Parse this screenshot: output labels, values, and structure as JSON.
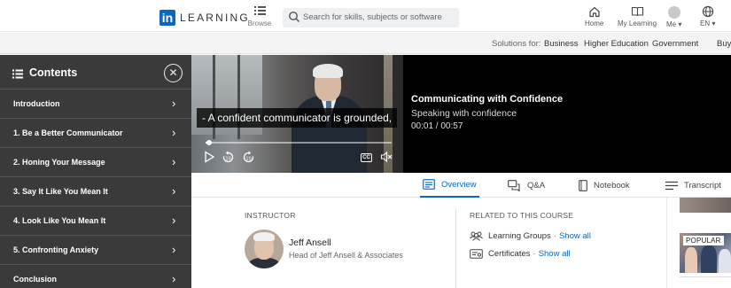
{
  "topnav": {
    "logo_mark": "in",
    "logo_text": "LEARNING",
    "browse_label": "Browse",
    "search_placeholder": "Search for skills, subjects or software",
    "home_label": "Home",
    "my_learning_label": "My Learning",
    "me_label": "Me",
    "language_label": "EN"
  },
  "subnav": {
    "solutions_label": "Solutions for:",
    "items": [
      "Business",
      "Higher Education",
      "Government",
      "Buy"
    ]
  },
  "sidebar": {
    "title": "Contents",
    "close_glyph": "✕",
    "items": [
      {
        "label": "Introduction"
      },
      {
        "label": "1. Be a Better Communicator"
      },
      {
        "label": "2. Honing Your Message"
      },
      {
        "label": "3. Say It Like You Mean It"
      },
      {
        "label": "4. Look Like You Mean It"
      },
      {
        "label": "5. Confronting Anxiety"
      },
      {
        "label": "Conclusion"
      }
    ]
  },
  "video": {
    "caption": "- A confident communicator is grounded,",
    "progress_fraction": 0.02,
    "cc_label": "CC"
  },
  "video_info": {
    "course_title": "Communicating with Confidence",
    "video_title": "Speaking with confidence",
    "time": "00:01 / 00:57"
  },
  "tabs": [
    {
      "label": "Overview",
      "icon": "overview-icon",
      "active": true
    },
    {
      "label": "Q&A",
      "icon": "qa-icon",
      "active": false
    },
    {
      "label": "Notebook",
      "icon": "notebook-icon",
      "active": false
    },
    {
      "label": "Transcript",
      "icon": "transcript-icon",
      "active": false
    }
  ],
  "overview": {
    "instructor_label": "INSTRUCTOR",
    "instructor_name": "Jeff Ansell",
    "instructor_title": "Head of Jeff Ansell & Associates",
    "related_label": "RELATED TO THIS COURSE",
    "related": [
      {
        "label": "Learning Groups",
        "separator": "·",
        "link": "Show all"
      },
      {
        "label": "Certificates",
        "separator": "·",
        "link": "Show all"
      }
    ]
  },
  "rail": {
    "badge": "POPULAR"
  },
  "colors": {
    "brand": "#0a66c2",
    "sidebar_bg": "#3a3a3a",
    "video_info_bg": "#000000"
  }
}
